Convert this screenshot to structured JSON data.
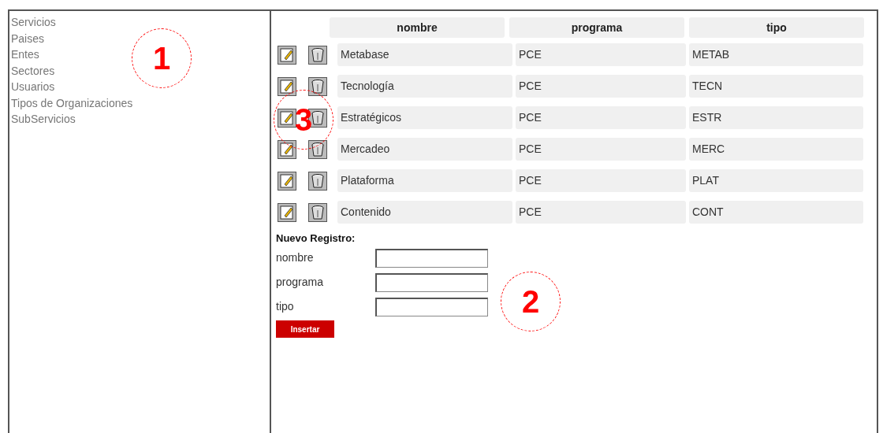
{
  "sidebar": {
    "items": [
      {
        "label": "Servicios"
      },
      {
        "label": "Paises"
      },
      {
        "label": "Entes"
      },
      {
        "label": "Sectores"
      },
      {
        "label": "Usuarios"
      },
      {
        "label": "Tipos de Organizaciones"
      },
      {
        "label": "SubServicios"
      }
    ]
  },
  "table": {
    "columns": [
      "nombre",
      "programa",
      "tipo"
    ],
    "rows": [
      [
        "Metabase",
        "PCE",
        "METAB"
      ],
      [
        "Tecnología",
        "PCE",
        "TECN"
      ],
      [
        "Estratégicos",
        "PCE",
        "ESTR"
      ],
      [
        "Mercadeo",
        "PCE",
        "MERC"
      ],
      [
        "Plataforma",
        "PCE",
        "PLAT"
      ],
      [
        "Contenido",
        "PCE",
        "CONT"
      ]
    ]
  },
  "form": {
    "title": "Nuevo Registro:",
    "fields": [
      {
        "label": "nombre"
      },
      {
        "label": "programa"
      },
      {
        "label": "tipo"
      }
    ],
    "submit": "Insertar"
  },
  "annotations": [
    "1",
    "2",
    "3"
  ]
}
